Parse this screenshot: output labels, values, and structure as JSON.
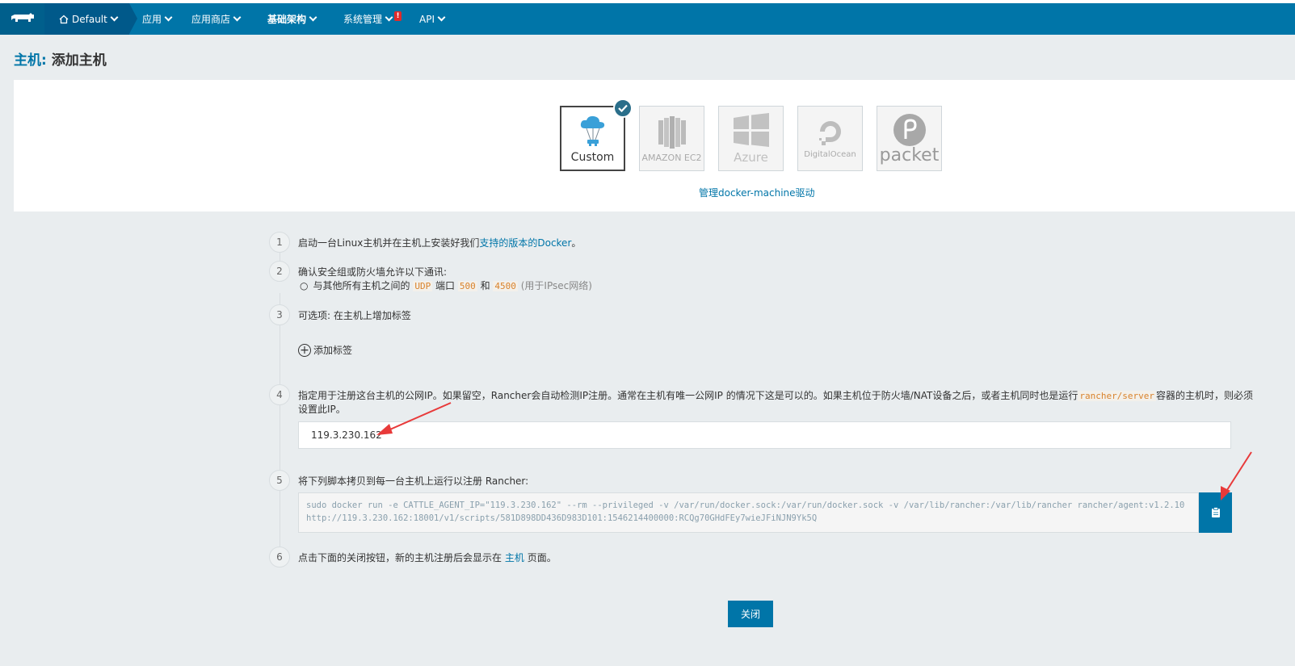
{
  "nav": {
    "logo": "rancher-cow-logo",
    "environment": "Default",
    "items": [
      "应用",
      "应用商店",
      "基础架构",
      "系统管理",
      "API"
    ],
    "alert": "!"
  },
  "page": {
    "crumb": "主机",
    "separator": ":",
    "title": "添加主机"
  },
  "drivers": [
    {
      "label": "Custom",
      "selected": true
    },
    {
      "label": "AMAZON EC2",
      "selected": false
    },
    {
      "label": "Azure",
      "selected": false
    },
    {
      "label": "DigitalOcean",
      "selected": false
    },
    {
      "label": "packet",
      "selected": false
    }
  ],
  "manage_link": "管理docker-machine驱动",
  "steps": {
    "s1": {
      "num": "1",
      "t1": "启动一台Linux主机并在主机上安装好我们",
      "link1": "支持的版本的",
      "link2": "Docker",
      "t2": "。"
    },
    "s2": {
      "num": "2",
      "text": "确认安全组或防火墙允许以下通讯:",
      "bullet_pre": "与其他所有主机之间的",
      "udp": "UDP",
      "port_word": "端口",
      "p1": "500",
      "and": "和",
      "p2": "4500",
      "note": "(用于IPsec网络)"
    },
    "s3": {
      "num": "3",
      "text": "可选项: 在主机上增加标签",
      "add_label": "添加标签"
    },
    "s4": {
      "num": "4",
      "line1_pre": "指定用于注册这台主机的公网IP。如果留空，Rancher会自动检测IP注册。通常在主机有唯一公网IP 的情况下这是可以的。如果主机位于防火墙/NAT设备之后，或者主机同时也是运行",
      "code": "rancher/server",
      "line1_post": "容器的主机时，则必须",
      "line2": "设置此IP。",
      "ip_value": "119.3.230.162"
    },
    "s5": {
      "num": "5",
      "text": "将下列脚本拷贝到每一台主机上运行以注册 Rancher:",
      "command": "sudo docker run -e CATTLE_AGENT_IP=\"119.3.230.162\"  --rm --privileged -v /var/run/docker.sock:/var/run/docker.sock -v /var/lib/rancher:/var/lib/rancher rancher/agent:v1.2.10 http://119.3.230.162:18001/v1/scripts/581D898DD436D983D101:1546214400000:RCQg70GHdFEy7wieJFiNJN9Yk5Q"
    },
    "s6": {
      "num": "6",
      "pre": "点击下面的关闭按钮，新的主机注册后会显示在",
      "link": "主机",
      "post": "页面。"
    }
  },
  "close_button": "关闭",
  "colors": {
    "brand": "#0075a8",
    "accent_code": "#d9822b",
    "annotation_arrow": "#e83a3a"
  }
}
